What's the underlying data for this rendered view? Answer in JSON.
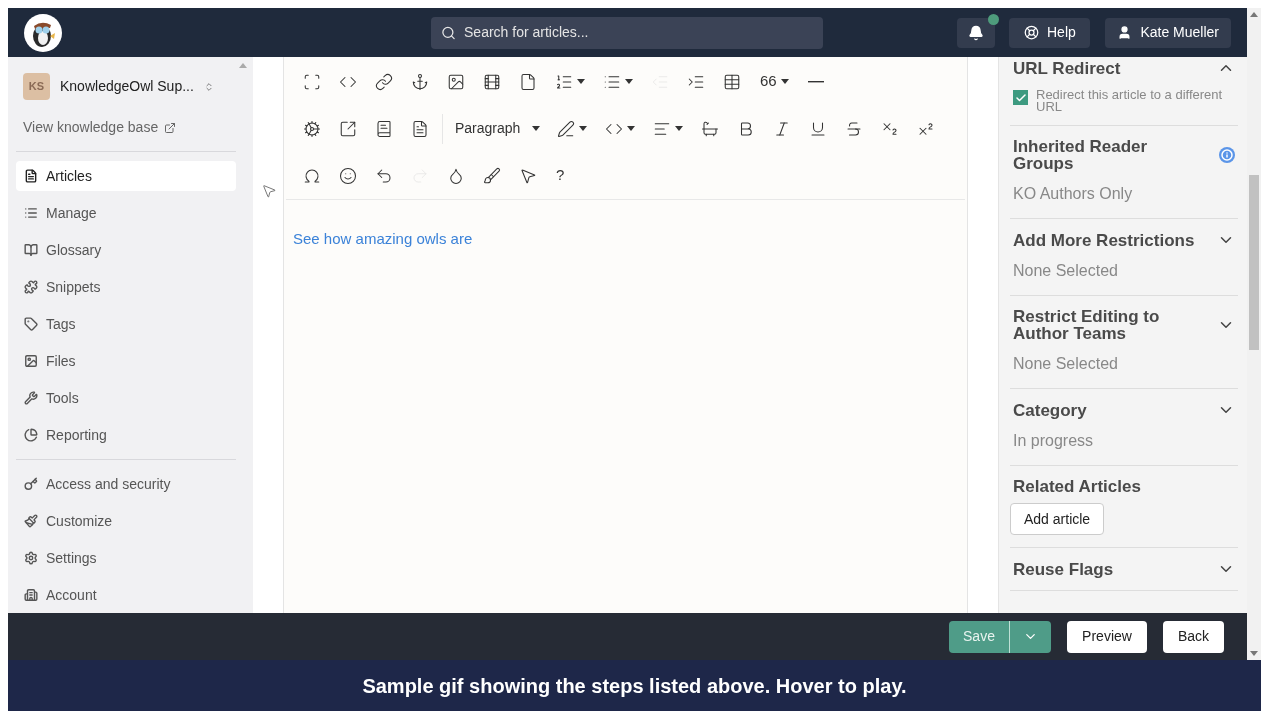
{
  "header": {
    "search": {
      "placeholder": "Search for articles..."
    },
    "help": "Help",
    "user": "Kate Mueller"
  },
  "sidebar": {
    "kb": {
      "initials": "KS",
      "name": "KnowledgeOwl Sup...",
      "view_link": "View knowledge base"
    },
    "nav": [
      {
        "label": "Articles",
        "selected": true
      },
      {
        "label": "Manage",
        "selected": false
      },
      {
        "label": "Glossary",
        "selected": false
      },
      {
        "label": "Snippets",
        "selected": false
      },
      {
        "label": "Tags",
        "selected": false
      },
      {
        "label": "Files",
        "selected": false
      },
      {
        "label": "Tools",
        "selected": false
      },
      {
        "label": "Reporting",
        "selected": false
      }
    ],
    "admin": [
      {
        "label": "Access and security",
        "selected": false
      },
      {
        "label": "Customize",
        "selected": false
      },
      {
        "label": "Settings",
        "selected": false
      },
      {
        "label": "Account",
        "selected": false
      }
    ]
  },
  "toolbar": {
    "rows": [
      [
        {
          "kind": "icon",
          "disabled": false
        },
        {
          "kind": "icon",
          "disabled": false
        },
        {
          "kind": "icon",
          "disabled": false
        },
        {
          "kind": "icon",
          "disabled": false
        },
        {
          "kind": "icon",
          "disabled": false
        },
        {
          "kind": "icon",
          "disabled": false
        },
        {
          "kind": "icon",
          "disabled": false
        },
        {
          "kind": "icon",
          "disabled": false
        },
        {
          "kind": "icon",
          "disabled": false
        },
        {
          "kind": "icon",
          "disabled": true
        },
        {
          "kind": "icon",
          "disabled": false
        },
        {
          "kind": "icon",
          "disabled": false
        },
        {
          "kind": "text",
          "label": "66"
        },
        {
          "kind": "icon",
          "disabled": false
        }
      ],
      [
        {
          "kind": "icon",
          "disabled": false
        },
        {
          "kind": "icon",
          "disabled": false
        },
        {
          "kind": "icon",
          "disabled": false
        },
        {
          "kind": "icon",
          "disabled": false
        },
        {
          "kind": "select",
          "label": "Paragraph"
        },
        {
          "kind": "icon",
          "disabled": false
        },
        {
          "kind": "icon",
          "disabled": false
        },
        {
          "kind": "icon",
          "disabled": false
        },
        {
          "kind": "icon",
          "disabled": false
        },
        {
          "kind": "icon",
          "disabled": false
        },
        {
          "kind": "icon",
          "disabled": false
        },
        {
          "kind": "icon",
          "disabled": false
        },
        {
          "kind": "icon",
          "disabled": false
        },
        {
          "kind": "icon",
          "disabled": false
        },
        {
          "kind": "icon",
          "disabled": false
        }
      ],
      [
        {
          "kind": "icon",
          "disabled": false
        },
        {
          "kind": "icon",
          "disabled": false
        },
        {
          "kind": "icon",
          "disabled": false
        },
        {
          "kind": "icon",
          "disabled": true
        },
        {
          "kind": "icon",
          "disabled": false
        },
        {
          "kind": "icon",
          "disabled": false
        },
        {
          "kind": "icon",
          "disabled": false
        },
        {
          "kind": "text",
          "label": "?"
        }
      ]
    ]
  },
  "editor": {
    "link": "See how amazing owls are"
  },
  "panel": {
    "sections": [
      {
        "kind": "checkbox",
        "title": "URL Redirect",
        "expanded": true,
        "checkbox": {
          "label": "Redirect this article to a different URL",
          "checked": true
        }
      },
      {
        "kind": "info",
        "title": "Inherited Reader Groups",
        "value": "KO Authors Only"
      },
      {
        "kind": "dropdown",
        "title": "Add More Restrictions",
        "expanded": false,
        "value": "None Selected"
      },
      {
        "kind": "dropdown",
        "title": "Restrict Editing to Author Teams",
        "expanded": false,
        "value": "None Selected"
      },
      {
        "kind": "dropdown",
        "title": "Category",
        "expanded": false,
        "value": "In progress"
      },
      {
        "kind": "button",
        "title": "Related Articles",
        "button": "Add article"
      },
      {
        "kind": "dropdown",
        "title": "Reuse Flags",
        "expanded": false
      }
    ]
  },
  "footer": {
    "save": "Save",
    "preview": "Preview",
    "back": "Back"
  },
  "caption": "Sample gif showing the steps listed above. Hover to play."
}
